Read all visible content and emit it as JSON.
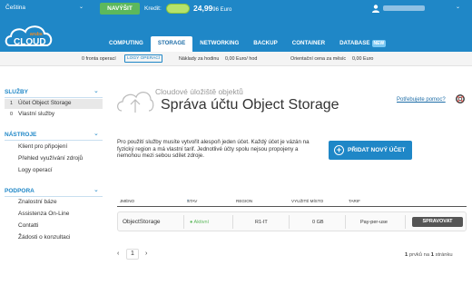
{
  "topbar": {
    "language": "Čeština",
    "topup_button": "NAVÝŠIT",
    "credit_label": "Kredit:",
    "credit_amount": "24,99",
    "credit_suffix": "96 Euro"
  },
  "nav": {
    "tabs": [
      {
        "label": "COMPUTING"
      },
      {
        "label": "STORAGE"
      },
      {
        "label": "NETWORKING"
      },
      {
        "label": "BACKUP"
      },
      {
        "label": "CONTAINER"
      },
      {
        "label": "DATABASE"
      }
    ],
    "new_badge": "NEW",
    "logo_top": "aruba",
    "logo_text": "CLOUD"
  },
  "strip": {
    "queue_text": "0 fronta operací",
    "queue_button": "LOGY OPERACÍ",
    "hourly_label": "Náklady za hodinu",
    "hourly_value": "0,00 Euro/ hod",
    "monthly_label": "Orientační cena za měsíc",
    "monthly_value": "0,00 Euro"
  },
  "sidebar": {
    "sections": [
      {
        "title": "SLUŽBY",
        "items": [
          {
            "num": "1",
            "label": "Účet Object Storage"
          },
          {
            "num": "0",
            "label": "Vlastní služby"
          }
        ]
      },
      {
        "title": "NÁSTROJE",
        "items": [
          {
            "label": "Klient pro připojení"
          },
          {
            "label": "Přehled využívání zdrojů"
          },
          {
            "label": "Logy operací"
          }
        ]
      },
      {
        "title": "PODPORA",
        "items": [
          {
            "label": "Znalostní báze"
          },
          {
            "label": "Assistenza On-Line"
          },
          {
            "label": "Contatti"
          },
          {
            "label": "Žádosti o konzultaci"
          }
        ]
      }
    ]
  },
  "main": {
    "subtitle": "Cloudové úložiště objektů",
    "title": "Správa účtu Object Storage",
    "help_link": "Potřebujete pomoc?",
    "description": "Pro použití služby musíte vytvořit alespoň jeden účet. Každý účet je vázán na fyzický region a má vlastní tarif. Jednotlivé účty spolu nejsou propojeny a nemohou mezi sebou sdílet zdroje.",
    "add_button": "PŘIDAT NOVÝ ÚČET"
  },
  "table": {
    "headers": [
      "JMÉNO",
      "STAV",
      "REGION",
      "VYUŽITÉ MÍSTO",
      "TARIF"
    ],
    "rows": [
      {
        "name": "ObjectStorage",
        "status": "● Aktivní",
        "region": "R1-IT",
        "usage": "0 GB",
        "tarif": "Pay-per-use",
        "action": "SPRAVOVAT"
      }
    ]
  },
  "pager": {
    "prev": "‹",
    "current": "1",
    "next": "›",
    "count": "1",
    "items_label": "prvků na",
    "pages": "1",
    "page_label": "stránku"
  },
  "colors": {
    "brand_blue": "#1f87c7",
    "topup_green": "#5cb85c",
    "status_green": "#5cb85c"
  }
}
